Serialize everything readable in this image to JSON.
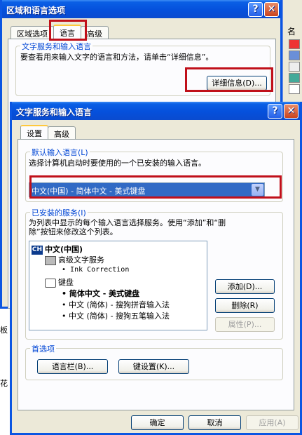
{
  "back_window": {
    "title": "区域和语言选项",
    "tabs": [
      "区域选项",
      "语言",
      "高级"
    ],
    "group_title": "文字服务和输入语言",
    "group_text": "要查看用来输入文字的语言和方法，请单击“详细信息”。",
    "details_button": "详细信息(D)..."
  },
  "front_window": {
    "title": "文字服务和输入语言",
    "tabs": [
      "设置",
      "高级"
    ],
    "default_group_title": "默认输入语言(L)",
    "default_group_text": "选择计算机启动时要使用的一个已安装的输入语言。",
    "default_value": "中文(中国) - 简体中文 - 美式键盘",
    "installed_group_title": "已安装的服务(I)",
    "installed_text_line1": "为列表中显示的每个输入语言选择服务。使用“添加”和“删",
    "installed_text_line2": "除”按钮来修改这个列表。",
    "tree": {
      "lang": "中文(中国)",
      "advanced_services": "高级文字服务",
      "ink": "Ink Correction",
      "keyboard": "键盘",
      "kb1": "简体中文 - 美式键盘",
      "kb2": "中文 (简体) - 搜狗拼音输入法",
      "kb3": "中文 (简体) - 搜狗五笔输入法"
    },
    "add_button": "添加(D)...",
    "remove_button": "删除(R)",
    "props_button": "属性(P)...",
    "prefs_title": "首选项",
    "langbar_button": "语言栏(B)...",
    "keysettings_button": "键设置(K)...",
    "ok": "确定",
    "cancel": "取消",
    "apply": "应用(A)"
  },
  "side_fragments": {
    "right_top": "名",
    "left_1": "板",
    "left_2": "花"
  },
  "colors": {
    "titlebar": "#0550dc",
    "highlight": "#c0101a",
    "selection": "#316ac5"
  }
}
